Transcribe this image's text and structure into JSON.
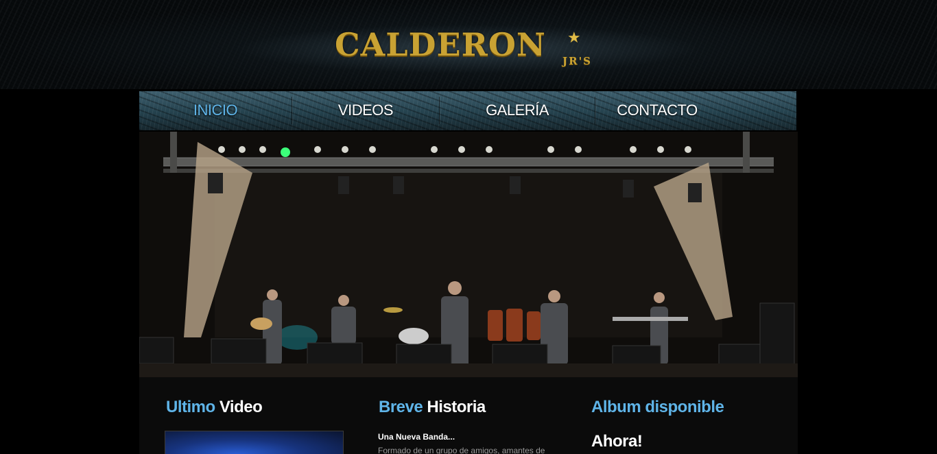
{
  "header": {
    "logo_main": "CALDERON",
    "logo_sub": "JR'S"
  },
  "nav": {
    "items": [
      {
        "label": "INICIO",
        "active": true
      },
      {
        "label": "VIDEOS",
        "active": false
      },
      {
        "label": "GALERÍA",
        "active": false
      },
      {
        "label": "CONTACTO",
        "active": false
      }
    ]
  },
  "hero": {
    "icon": "stage-photo"
  },
  "sections": {
    "video": {
      "title_highlight": "Ultimo",
      "title_rest": "Video"
    },
    "history": {
      "title_highlight": "Breve",
      "title_rest": "Historia",
      "subtitle": "Una Nueva Banda...",
      "body": "Formado de un grupo de amigos, amantes de"
    },
    "album": {
      "title_highlight": "Album disponible",
      "subtitle": "Ahora!"
    }
  },
  "colors": {
    "accent": "#5fb4e8",
    "logo_gold": "#c9a233",
    "background": "#000000"
  }
}
